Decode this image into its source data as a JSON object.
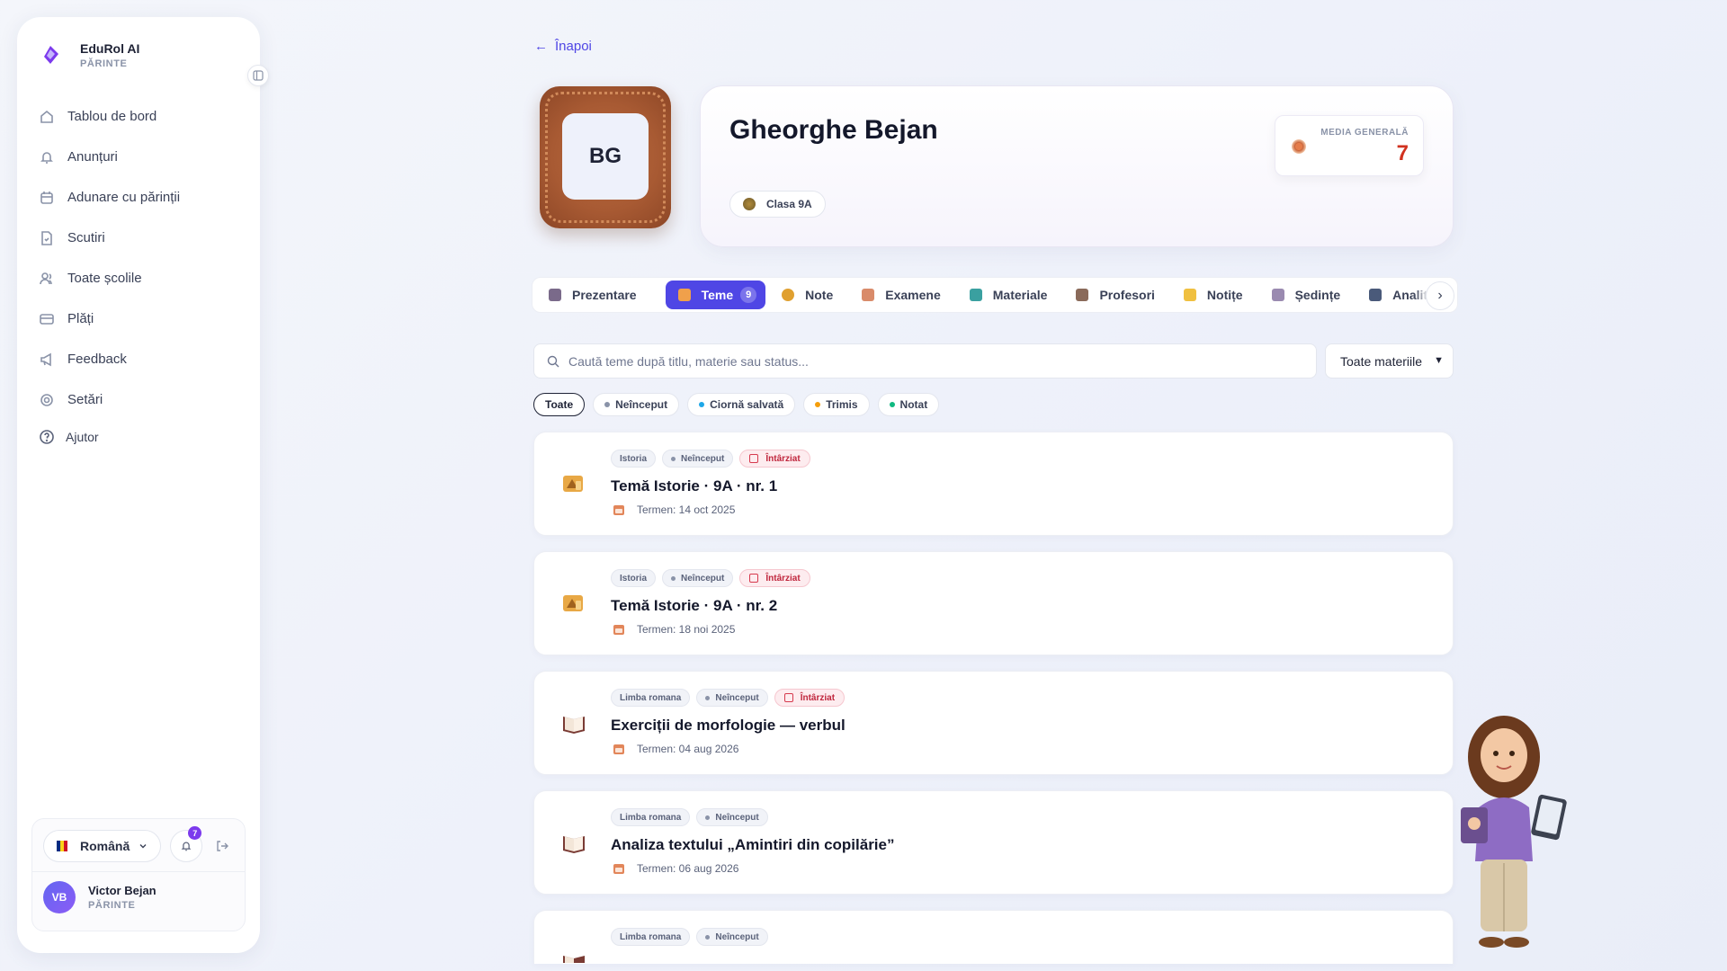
{
  "brand": {
    "name": "EduRol AI",
    "role": "PĂRINTE"
  },
  "nav": [
    {
      "label": "Tablou de bord",
      "icon": "home-icon"
    },
    {
      "label": "Anunțuri",
      "icon": "bell-icon"
    },
    {
      "label": "Adunare cu părinții",
      "icon": "calendar-icon"
    },
    {
      "label": "Scutiri",
      "icon": "document-icon"
    },
    {
      "label": "Toate școlile",
      "icon": "users-icon"
    },
    {
      "label": "Plăți",
      "icon": "card-icon"
    },
    {
      "label": "Feedback",
      "icon": "megaphone-icon"
    },
    {
      "label": "Setări",
      "icon": "gear-icon"
    }
  ],
  "help": {
    "label": "Ajutor",
    "icon": "help-icon"
  },
  "footer": {
    "language": "Română",
    "notifications": "7",
    "user_initials": "VB",
    "user_name": "Victor Bejan",
    "user_role": "PĂRINTE"
  },
  "back_label": "Înapoi",
  "student": {
    "initials": "BG",
    "name": "Gheorghe Bejan",
    "class": "Clasa 9A",
    "average_label": "MEDIA GENERALĂ",
    "average_value": "7"
  },
  "tabs": [
    {
      "label": "Prezentare",
      "color": "#7a6a8a"
    },
    {
      "label": "Teme",
      "count": "9",
      "active": true,
      "color": "#f0a04b"
    },
    {
      "label": "Note",
      "color": "#e0a030"
    },
    {
      "label": "Examene",
      "color": "#d98b6a"
    },
    {
      "label": "Materiale",
      "color": "#3aa0a0"
    },
    {
      "label": "Profesori",
      "color": "#8a6a5a"
    },
    {
      "label": "Notițe",
      "color": "#f0c040"
    },
    {
      "label": "Ședințe",
      "color": "#9a8ab0"
    },
    {
      "label": "Analitic",
      "color": "#4a5a7a"
    }
  ],
  "search": {
    "placeholder": "Caută teme după titlu, materie sau status..."
  },
  "subject_filter": {
    "selected": "Toate materiile"
  },
  "filters": [
    {
      "label": "Toate",
      "active": true,
      "color": ""
    },
    {
      "label": "Neînceput",
      "color": "#8a93a8"
    },
    {
      "label": "Ciornă salvată",
      "color": "#1ea7e8"
    },
    {
      "label": "Trimis",
      "color": "#f59e0b"
    },
    {
      "label": "Notat",
      "color": "#10b981"
    }
  ],
  "homework": [
    {
      "subject": "Istoria",
      "status": "Neînceput",
      "late": "Întârziat",
      "title": "Temă Istorie · 9A · nr. 1",
      "due": "Termen: 14 oct 2025",
      "icon": "history-icon"
    },
    {
      "subject": "Istoria",
      "status": "Neînceput",
      "late": "Întârziat",
      "title": "Temă Istorie · 9A · nr. 2",
      "due": "Termen: 18 noi 2025",
      "icon": "history-icon"
    },
    {
      "subject": "Limba romana",
      "status": "Neînceput",
      "late": "Întârziat",
      "title": "Exerciții de morfologie — verbul",
      "due": "Termen: 04 aug 2026",
      "icon": "book-icon"
    },
    {
      "subject": "Limba romana",
      "status": "Neînceput",
      "late": "",
      "title": "Analiza textului „Amintiri din copilărie”",
      "due": "Termen: 06 aug 2026",
      "icon": "book-icon"
    },
    {
      "subject": "Limba romana",
      "status": "Neînceput",
      "late": "",
      "title": "",
      "due": "",
      "icon": "book-icon"
    }
  ]
}
